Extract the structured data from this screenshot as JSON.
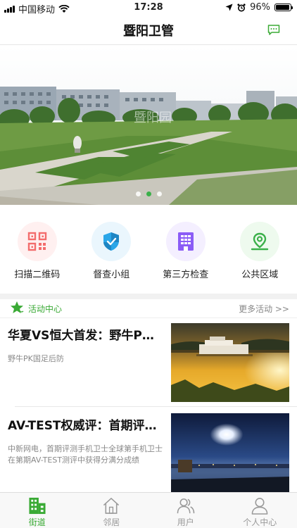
{
  "status_bar": {
    "carrier": "中国移动",
    "time": "17:28",
    "battery": "96%",
    "battery_level": 0.96
  },
  "header": {
    "title": "暨阳卫管",
    "message_icon": "chat-bubble-icon"
  },
  "banner": {
    "slide_count": 3,
    "active_index": 1
  },
  "quick_menu": [
    {
      "label": "扫描二维码",
      "icon": "qr-code-icon",
      "color": "#f36c6c",
      "bg": "#fff0f0"
    },
    {
      "label": "督查小组",
      "icon": "shield-icon",
      "color": "#2aa6e8",
      "bg": "#eaf6fd"
    },
    {
      "label": "第三方检查",
      "icon": "building-icon",
      "color": "#8b5cf6",
      "bg": "#f4efff"
    },
    {
      "label": "公共区域",
      "icon": "map-pin-icon",
      "color": "#3bb04a",
      "bg": "#eefaee"
    }
  ],
  "activity": {
    "title": "活动中心",
    "more": "更多活动 >>",
    "items": [
      {
        "title": "华夏VS恒大首发：野牛PK国足后防",
        "desc": "野牛PK国足后防"
      },
      {
        "title": "AV-TEST权威评：首期评测手机卫士",
        "desc": "中新网电，首期评测手机卫士全球第手机卫士在第期AV-TEST测评中获得分满分成绩"
      }
    ]
  },
  "tabbar": [
    {
      "label": "街道",
      "icon": "building-icon",
      "active": true
    },
    {
      "label": "邻居",
      "icon": "house-icon",
      "active": false
    },
    {
      "label": "用户",
      "icon": "users-icon",
      "active": false
    },
    {
      "label": "个人中心",
      "icon": "person-icon",
      "active": false
    }
  ],
  "colors": {
    "accent": "#3aaa35",
    "inactive": "#999999"
  }
}
